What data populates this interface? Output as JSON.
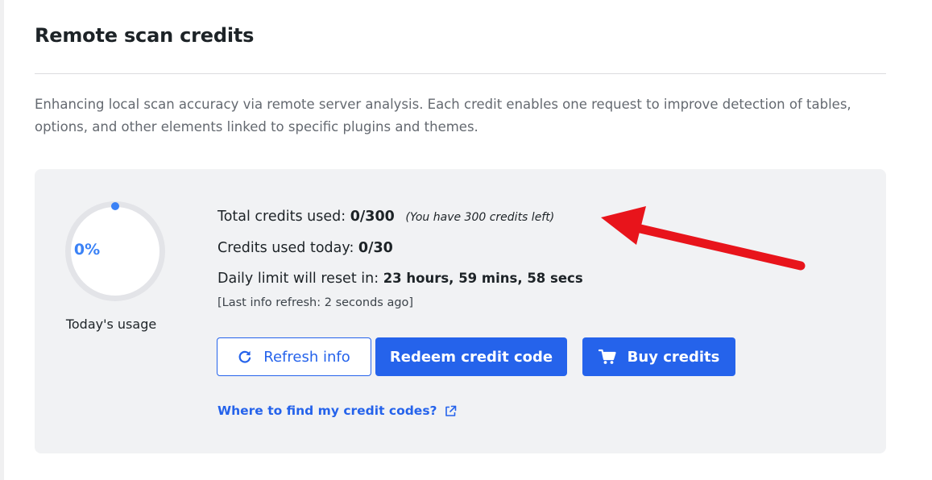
{
  "section": {
    "title": "Remote scan credits",
    "description": "Enhancing local scan accuracy via remote server analysis. Each credit enables one request to improve detection of tables, options, and other elements linked to specific plugins and themes."
  },
  "usage": {
    "percent_label": "0%",
    "percent_value": 0,
    "caption": "Today's usage",
    "accent_color": "#3b82f6"
  },
  "stats": {
    "total_label": "Total credits used:",
    "total_value": "0/300",
    "total_note": "(You have 300 credits left)",
    "today_label": "Credits used today:",
    "today_value": "0/30",
    "reset_label": "Daily limit will reset in:",
    "reset_value": "23 hours, 59 mins, 58 secs",
    "refresh_note": "[Last info refresh: 2 seconds ago]"
  },
  "actions": {
    "refresh_label": "Refresh info",
    "redeem_label": "Redeem credit code",
    "buy_label": "Buy credits",
    "help_link": "Where to find my credit codes?"
  },
  "icons": {
    "refresh": "refresh-icon",
    "cart": "cart-icon",
    "external": "external-link-icon",
    "annotation": "red-arrow-annotation"
  },
  "colors": {
    "primary": "#2563eb",
    "panel_bg": "#f1f2f4",
    "annotation": "#e8141b"
  }
}
